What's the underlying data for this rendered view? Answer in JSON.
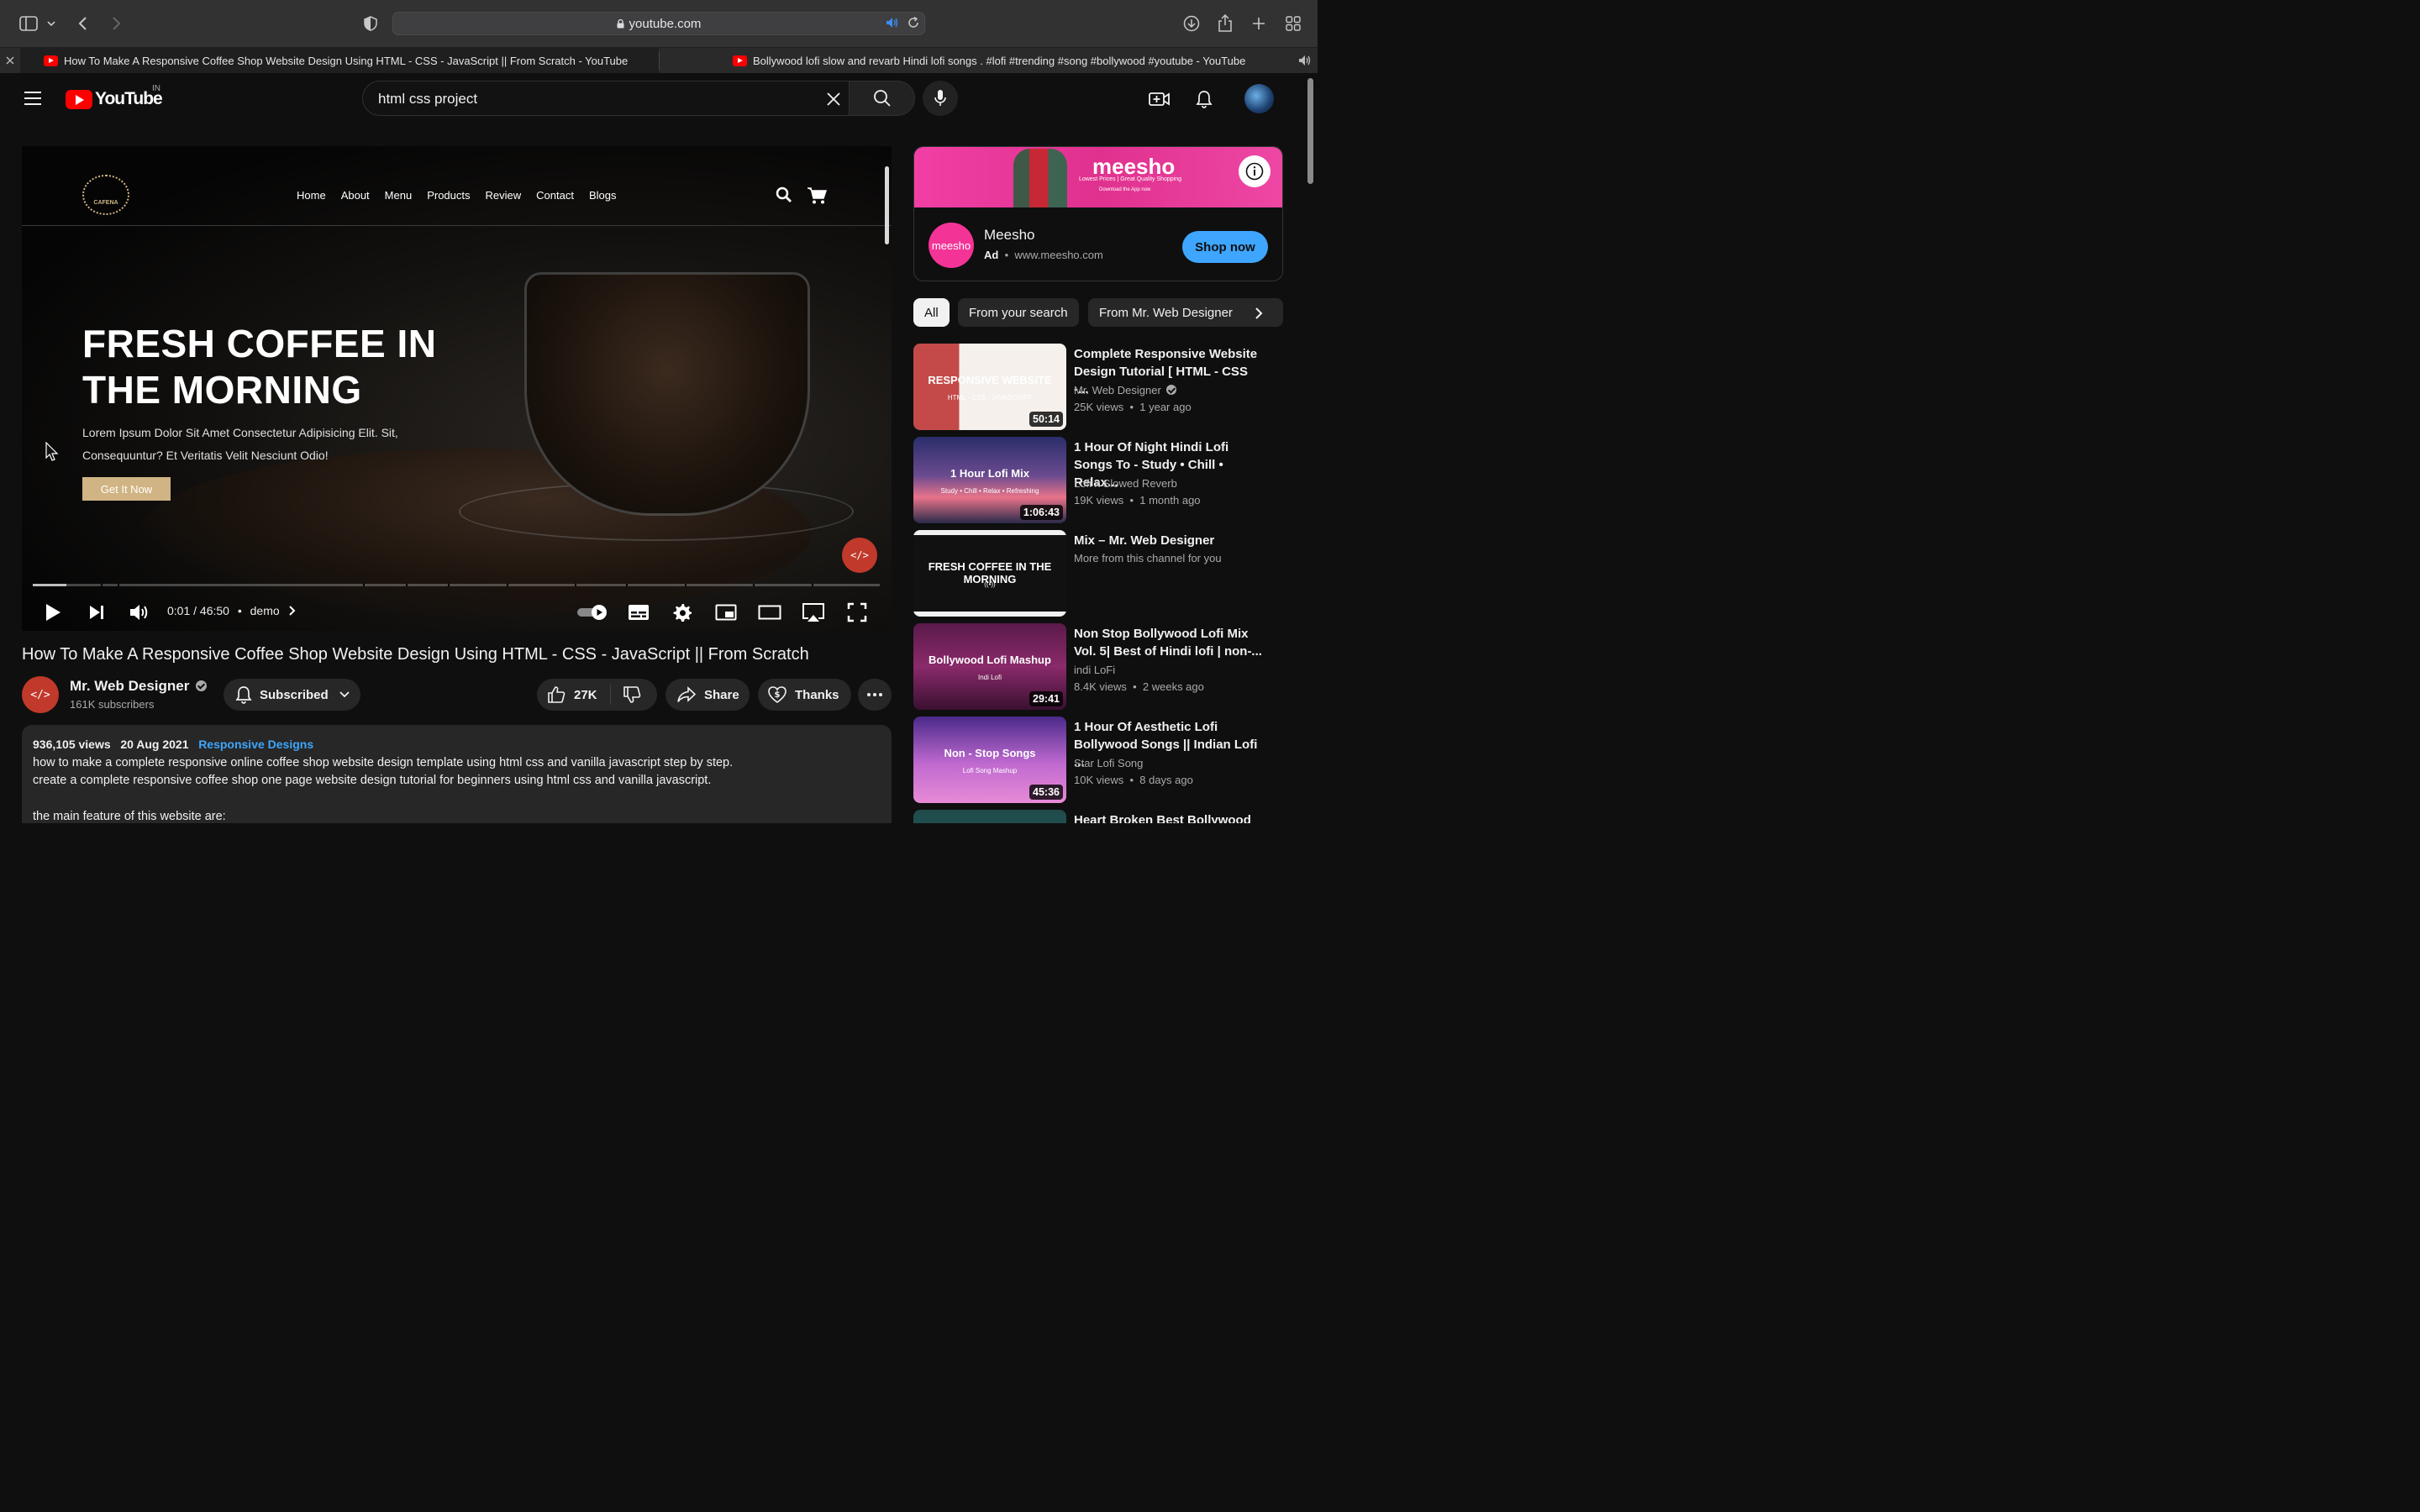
{
  "browser": {
    "url": "youtube.com",
    "tabs": [
      {
        "title": "How To Make A Responsive Coffee Shop Website Design Using HTML - CSS - JavaScript || From Scratch - YouTube"
      },
      {
        "title": "Bollywood lofi slow and revarb Hindi lofi songs . #lofi #trending #song #bollywood #youtube - YouTube"
      }
    ]
  },
  "header": {
    "logo": "YouTube",
    "country": "IN",
    "search_value": "html css project"
  },
  "player": {
    "site": {
      "logo_text": "CAFENA",
      "links": [
        "Home",
        "About",
        "Menu",
        "Products",
        "Review",
        "Contact",
        "Blogs"
      ],
      "hero_title": "FRESH COFFEE IN\nTHE MORNING",
      "hero_text": "Lorem Ipsum Dolor Sit Amet Consectetur Adipisicing Elit. Sit, Consequuntur? Et Veritatis Velit Nesciunt Odio!",
      "hero_button": "Get It Now"
    },
    "watermark": "</>",
    "progress": 0.04,
    "time": "0:01 / 46:50",
    "chapter": "demo"
  },
  "video": {
    "title": "How To Make A Responsive Coffee Shop Website Design Using HTML - CSS - JavaScript || From Scratch",
    "channel": "Mr. Web Designer",
    "channel_avatar": "</>",
    "subscribers": "161K subscribers",
    "subscribed_label": "Subscribed",
    "likes": "27K",
    "share_label": "Share",
    "thanks_label": "Thanks"
  },
  "description": {
    "views": "936,105 views",
    "date": "20 Aug 2021",
    "tag": "Responsive Designs",
    "line1": "how to make a complete responsive online coffee shop website design template using html css and vanilla javascript step by step.",
    "line2": "create a complete responsive coffee shop one page website design tutorial for beginners using html css and vanilla javascript.",
    "line3": "the main feature of this website are:"
  },
  "ad": {
    "brand": "meesho",
    "tagline": "Lowest Prices | Great Quality Shopping",
    "download": "Download the App now",
    "logo_text": "meesho",
    "name": "Meesho",
    "ad_label": "Ad",
    "domain": "www.meesho.com",
    "button": "Shop now"
  },
  "chips": [
    "All",
    "From your search",
    "From Mr. Web Designer"
  ],
  "recommendations": [
    {
      "title": "Complete Responsive Website Design Tutorial [ HTML - CSS -...",
      "channel": "Mr. Web Designer",
      "verified": true,
      "views": "25K views",
      "age": "1 year ago",
      "duration": "50:14",
      "thumb_text": "RESPONSIVE WEBSITE",
      "thumb_sub": "HTML - CSS - JAVASCRIPT"
    },
    {
      "title": "1 Hour Of Night Hindi Lofi Songs To - Study • Chill • Relax...",
      "channel": "Lofi x Slowed Reverb",
      "verified": false,
      "views": "19K views",
      "age": "1 month ago",
      "duration": "1:06:43",
      "thumb_text": "1 Hour Lofi Mix",
      "thumb_sub": "Study • Chill • Relax • Refreshing"
    },
    {
      "title": "Mix – Mr. Web Designer",
      "channel": "More from this channel for you",
      "verified": false,
      "views": "",
      "age": "",
      "duration": "",
      "thumb_text": "FRESH COFFEE IN THE MORNING",
      "thumb_sub": "((•))"
    },
    {
      "title": "Non Stop Bollywood Lofi Mix Vol. 5| Best of Hindi lofi | non-...",
      "channel": "indi LoFi",
      "verified": false,
      "views": "8.4K views",
      "age": "2 weeks ago",
      "duration": "29:41",
      "thumb_text": "Bollywood Lofi Mashup",
      "thumb_sub": "Indi Lofi"
    },
    {
      "title": "1 Hour Of Aesthetic Lofi Bollywood Songs || Indian Lofi ...",
      "channel": "Star Lofi Song",
      "verified": false,
      "views": "10K views",
      "age": "8 days ago",
      "duration": "45:36",
      "thumb_text": "Non - Stop Songs",
      "thumb_sub": "Lofi Song Mashup"
    },
    {
      "title": "Heart Broken Best Bollywood",
      "channel": "",
      "verified": false,
      "views": "",
      "age": "",
      "duration": "",
      "thumb_text": "",
      "thumb_sub": ""
    }
  ]
}
